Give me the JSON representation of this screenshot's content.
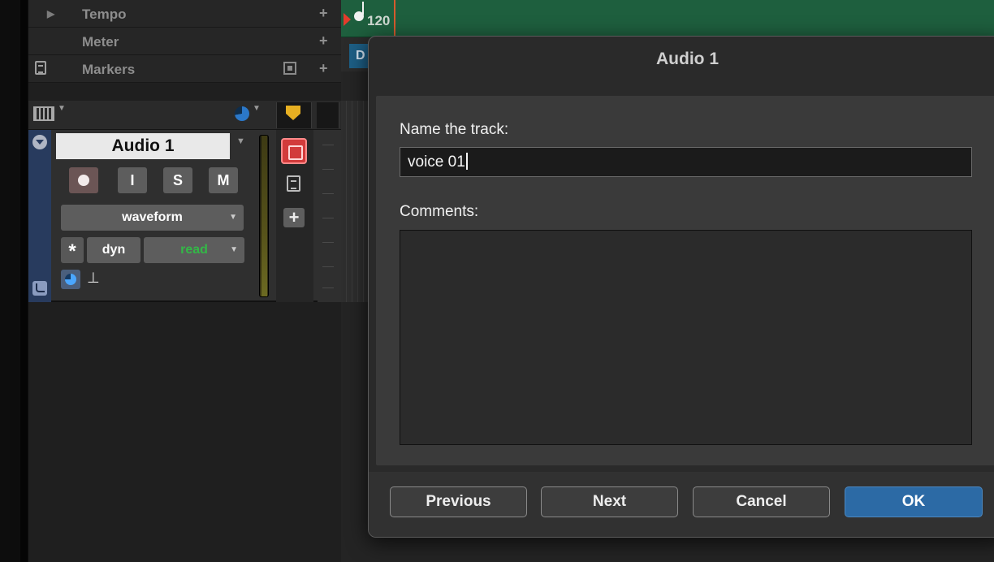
{
  "rulers": {
    "tempo_label": "Tempo",
    "meter_label": "Meter",
    "markers_label": "Markers"
  },
  "tempo_lane": {
    "tempo_value": "120",
    "meter_clip": "D"
  },
  "track": {
    "name": "Audio 1",
    "input_label": "I",
    "solo_label": "S",
    "mute_label": "M",
    "view_mode": "waveform",
    "timebase_symbol": "*",
    "dyn_label": "dyn",
    "automation_mode": "read",
    "fader_glyph": "⊥",
    "add_glyph": "+"
  },
  "dialog": {
    "title": "Audio 1",
    "name_label": "Name the track:",
    "name_value": "voice 01",
    "comments_label": "Comments:",
    "comments_value": "",
    "buttons": {
      "previous": "Previous",
      "next": "Next",
      "cancel": "Cancel",
      "ok": "OK"
    }
  },
  "colors": {
    "accent_ok": "#2c6aa5",
    "tempo_lane": "#1e5f3e",
    "track_select": "#283b5e",
    "record_enable": "#d23b3b",
    "automation_read": "#33b847",
    "marker_yellow": "#e7b022"
  },
  "icons": {
    "markers": "comment-icon",
    "ruler_view": "view-square-icon",
    "columns": "column-view-icon",
    "pan": "pan-icon",
    "marker": "marker-shield-icon",
    "disclose": "disclosure-triangle-icon",
    "record": "record-icon",
    "playlist": "playlist-icon",
    "comments": "comment-icon",
    "add": "plus-icon"
  }
}
